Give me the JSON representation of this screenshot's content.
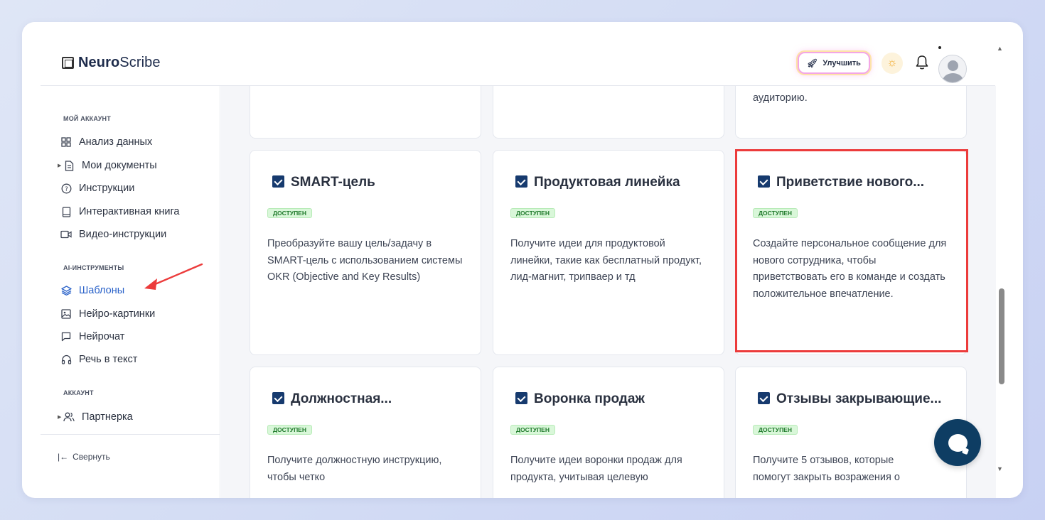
{
  "brand": {
    "name_bold": "Neuro",
    "name_regular": "Scribe"
  },
  "header": {
    "upgrade_label": "Улучшить"
  },
  "sidebar": {
    "sections": [
      {
        "label": "МОЙ АККАУНТ"
      },
      {
        "label": "AI-ИНСТРУМЕНТЫ"
      },
      {
        "label": "АККАУНТ"
      }
    ],
    "items": [
      {
        "label": "Анализ данных",
        "icon": "grid-icon"
      },
      {
        "label": "Мои документы",
        "icon": "document-icon"
      },
      {
        "label": "Инструкции",
        "icon": "help-circle-icon"
      },
      {
        "label": "Интерактивная книга",
        "icon": "book-icon"
      },
      {
        "label": "Видео-инструкции",
        "icon": "video-icon"
      },
      {
        "label": "Шаблоны",
        "icon": "layers-icon",
        "active": true
      },
      {
        "label": "Нейро-картинки",
        "icon": "image-icon"
      },
      {
        "label": "Нейрочат",
        "icon": "chat-icon"
      },
      {
        "label": "Речь в текст",
        "icon": "headphones-icon"
      },
      {
        "label": "Партнерка",
        "icon": "users-icon"
      }
    ],
    "collapse_label": "Свернуть"
  },
  "content": {
    "top_partial_text": "аудиторию.",
    "cards": [
      {
        "title": "SMART-цель",
        "badge": "доступен",
        "desc": "Преобразуйте вашу цель/задачу в SMART-цель с использованием системы OKR (Objective and Key Results)"
      },
      {
        "title": "Продуктовая линейка",
        "badge": "доступен",
        "desc": "Получите идеи для продуктовой линейки, такие как бесплатный продукт, лид-магнит, трипваер и тд"
      },
      {
        "title": "Приветствие нового...",
        "badge": "доступен",
        "desc": "Создайте персональное сообщение для нового сотрудника, чтобы приветствовать его в команде и создать положительное впечатление."
      },
      {
        "title": "Должностная...",
        "badge": "доступен",
        "desc": "Получите должностную инструкцию, чтобы четко"
      },
      {
        "title": "Воронка продаж",
        "badge": "доступен",
        "desc": "Получите идеи воронки продаж для продукта, учитывая целевую"
      },
      {
        "title": "Отзывы закрывающие...",
        "badge": "доступен",
        "desc": "Получите 5 отзывов, которые помогут закрыть возражения о"
      }
    ]
  },
  "colors": {
    "accent": "#2a62c9",
    "highlight": "#ec3b3b",
    "fab": "#0e3d63",
    "badge_bg": "#d9f7d9"
  }
}
